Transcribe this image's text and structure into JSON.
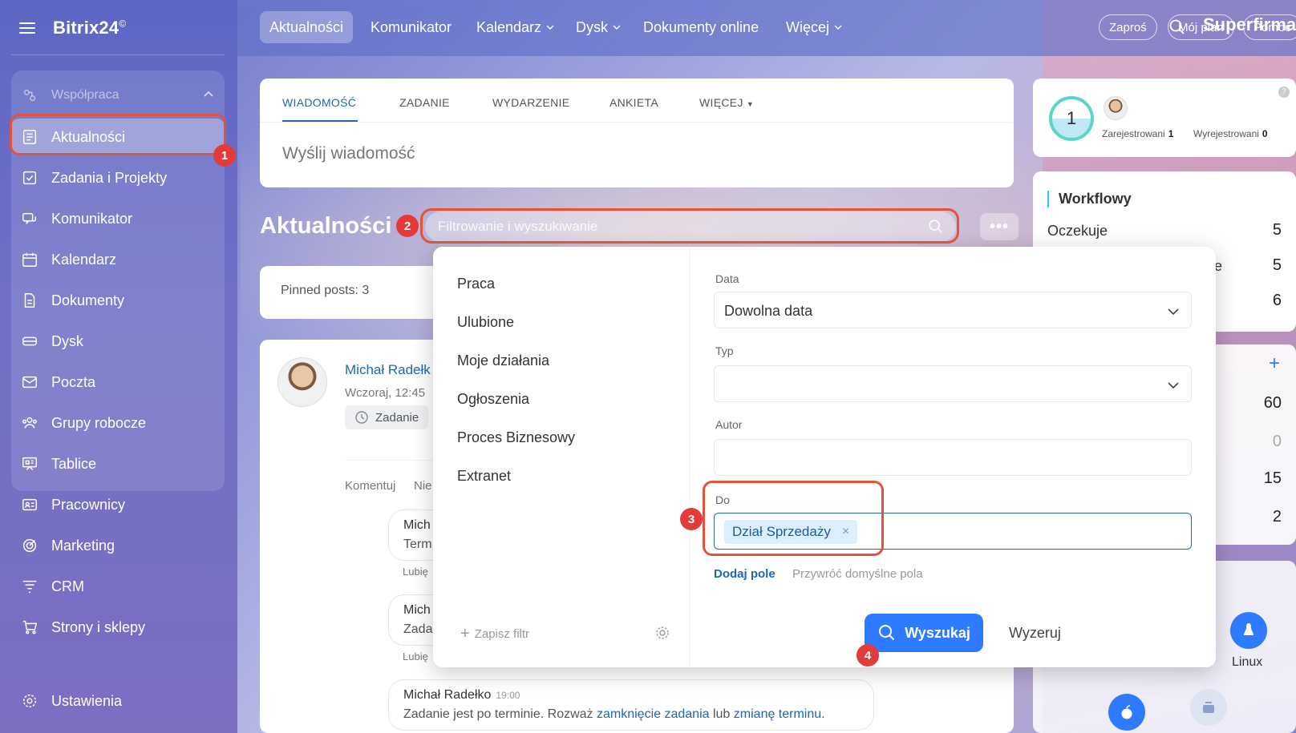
{
  "app": {
    "logo": "Bitrix24",
    "logo_mark": "©"
  },
  "sidebar": {
    "group_label": "Współpraca",
    "items": [
      {
        "label": "Aktualności"
      },
      {
        "label": "Zadania i Projekty"
      },
      {
        "label": "Komunikator"
      },
      {
        "label": "Kalendarz"
      },
      {
        "label": "Dokumenty"
      },
      {
        "label": "Dysk"
      },
      {
        "label": "Poczta"
      },
      {
        "label": "Grupy robocze"
      },
      {
        "label": "Tablice"
      },
      {
        "label": "Pracownicy"
      },
      {
        "label": "Marketing"
      },
      {
        "label": "CRM"
      },
      {
        "label": "Strony i sklepy"
      },
      {
        "label": "Ustawienia"
      }
    ]
  },
  "topnav": {
    "items": [
      "Aktualności",
      "Komunikator",
      "Kalendarz",
      "Dysk",
      "Dokumenty online",
      "Więcej"
    ],
    "company": "Superfirma",
    "invite": "Zaproś",
    "plan": "Mój plan",
    "help": "Pomoc"
  },
  "composer": {
    "tabs": [
      "WIADOMOŚĆ",
      "ZADANIE",
      "WYDARZENIE",
      "ANKIETA",
      "WIĘCEJ"
    ],
    "placeholder": "Wyślij wiadomość"
  },
  "page": {
    "title": "Aktualności",
    "filter_placeholder": "Filtrowanie i wyszukiwanie"
  },
  "feed": {
    "pinned": "Pinned posts: 3",
    "post_author": "Michał Radełk",
    "post_time": "Wczoraj, 12:45",
    "post_chip": "Zadanie",
    "actions": [
      "Komentuj",
      "Nie"
    ],
    "comment1": {
      "name": "Mich",
      "text": "Term",
      "like": "Lubię"
    },
    "comment2": {
      "name": "Mich",
      "text": "Zada",
      "like": "Lubię"
    },
    "comment3": {
      "name": "Michał Radełko",
      "time": "19:00",
      "text_pre": "Zadanie jest po terminie. Rozważ ",
      "link1": "zamknięcie zadania",
      "mid": " lub ",
      "link2": "zmianę terminu",
      "end": "."
    }
  },
  "right": {
    "reg_count": "1",
    "registered_label": "Zarejestrowani",
    "registered": "1",
    "unregistered_label": "Wyrejestrowani",
    "unregistered": "0",
    "workflow_title": "Workflowy",
    "wf_rows": [
      {
        "label": "Oczekuje",
        "value": "5"
      },
      {
        "label": "e",
        "value": "5"
      },
      {
        "label": "",
        "value": "6"
      }
    ],
    "stats": [
      "60",
      "0",
      "15",
      "2"
    ],
    "plus": "+",
    "linux": "Linux"
  },
  "filter": {
    "presets": [
      "Praca",
      "Ulubione",
      "Moje działania",
      "Ogłoszenia",
      "Proces Biznesowy",
      "Extranet"
    ],
    "save_filter": "Zapisz filtr",
    "fields": {
      "date_label": "Data",
      "date_value": "Dowolna data",
      "type_label": "Typ",
      "author_label": "Autor",
      "to_label": "Do",
      "to_tag": "Dział Sprzedaży"
    },
    "add_field": "Dodaj pole",
    "restore_fields": "Przywróć domyślne pola",
    "search_button": "Wyszukaj",
    "reset_button": "Wyzeruj"
  },
  "annotations": [
    "1",
    "2",
    "3",
    "4"
  ],
  "colors": {
    "highlight": "#e2533a",
    "badge": "#e33a3a",
    "primary": "#2f7bff",
    "link": "#2067b0"
  }
}
